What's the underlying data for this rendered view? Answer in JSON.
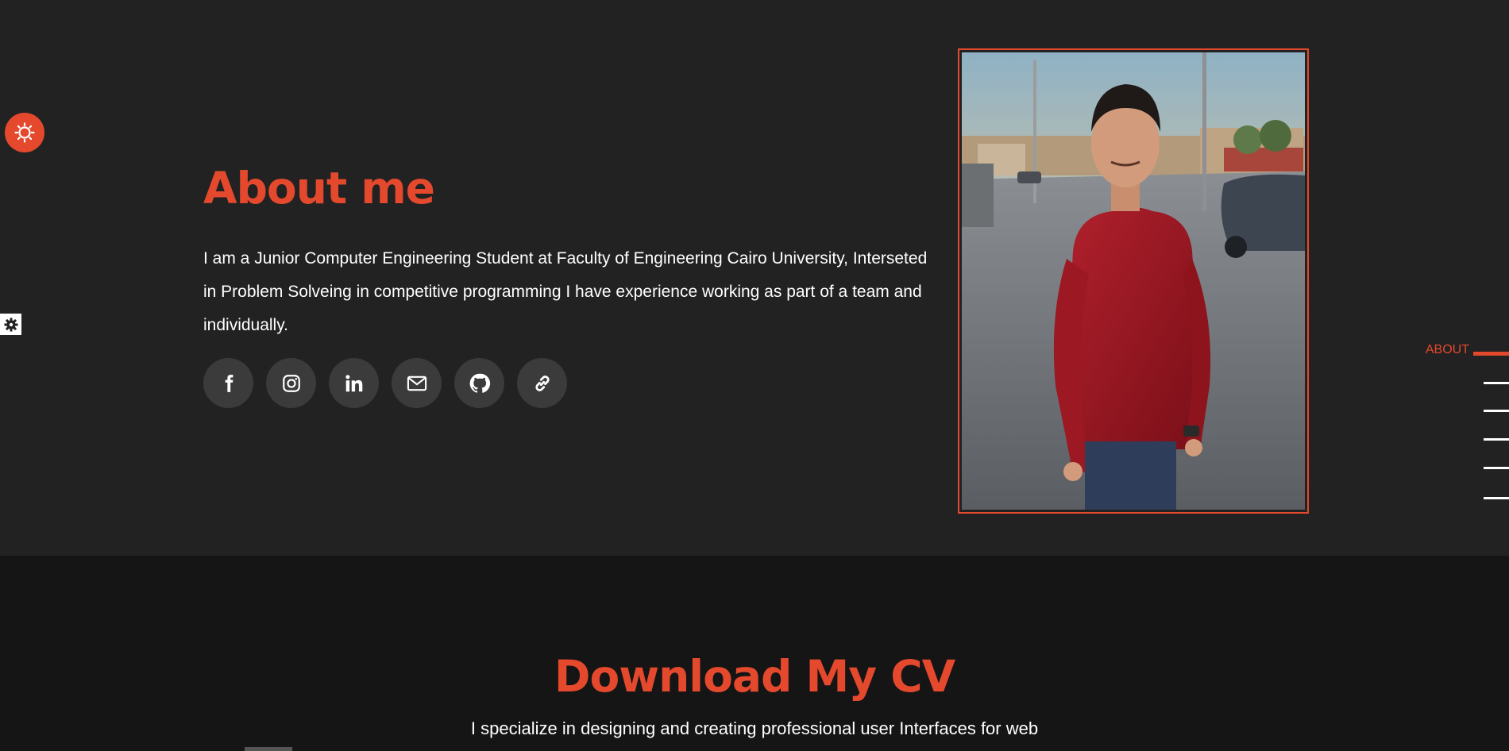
{
  "about": {
    "title": "About me",
    "text": "I am a Junior Computer Engineering Student at Faculty of Engineering Cairo University, Interseted in Problem Solveing in competitive programming I have experience working as part of a team and individually.",
    "socials": [
      {
        "name": "facebook",
        "icon": "facebook-icon"
      },
      {
        "name": "instagram",
        "icon": "instagram-icon"
      },
      {
        "name": "linkedin",
        "icon": "linkedin-icon"
      },
      {
        "name": "email",
        "icon": "mail-icon"
      },
      {
        "name": "github",
        "icon": "github-icon"
      },
      {
        "name": "link",
        "icon": "link-icon"
      }
    ]
  },
  "side_nav": {
    "active_label": "ABOUT",
    "items_count_hint": "6"
  },
  "cv": {
    "title": "Download My CV",
    "subtitle": "I specialize in designing and creating professional user Interfaces for web"
  },
  "colors": {
    "accent": "#e4492d",
    "background": "#222222",
    "background_dark": "#151515",
    "social_bg": "#3b3b3b"
  }
}
